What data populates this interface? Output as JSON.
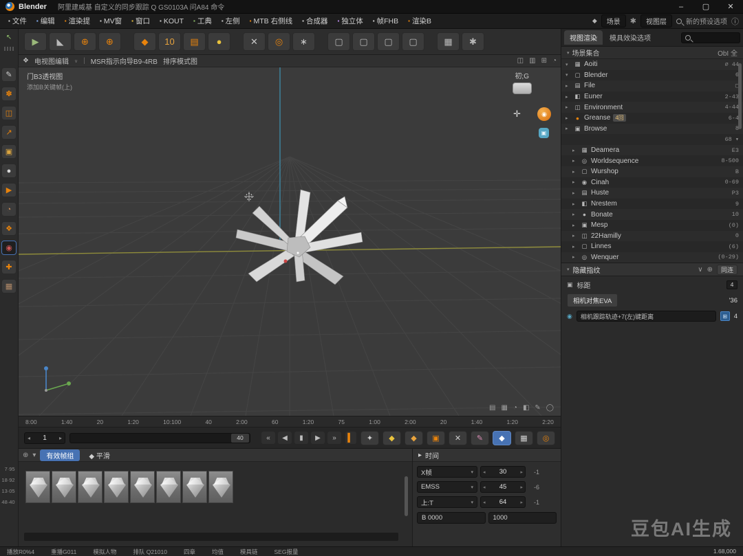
{
  "titlebar": {
    "app": "Blender",
    "title": "阿里建威基 自定义的同步跟踪 Q GS0103A 问A84 命令",
    "minimize": "–",
    "maximize": "▢",
    "close": "✕"
  },
  "menubar": {
    "items": [
      {
        "icon": "▪",
        "c": "#cfcfcf",
        "label": "文件"
      },
      {
        "icon": "▪",
        "c": "#8ab4f8",
        "label": "编辑"
      },
      {
        "icon": "▪",
        "c": "#e8830c",
        "label": "渲染提"
      },
      {
        "icon": "▪",
        "c": "#cfcfcf",
        "label": "MV窗"
      },
      {
        "icon": "▪",
        "c": "#e8c23d",
        "label": "窗口"
      },
      {
        "icon": "▪",
        "c": "#cfcfcf",
        "label": "KOUT"
      },
      {
        "icon": "▪",
        "c": "#8fbf6a",
        "label": "工典"
      },
      {
        "icon": "▪",
        "c": "#cfcfcf",
        "label": "左侧"
      },
      {
        "icon": "▪",
        "c": "#e8830c",
        "label": "MTB 右侧线"
      },
      {
        "icon": "▪",
        "c": "#cfcfcf",
        "label": "合成器"
      },
      {
        "icon": "▪",
        "c": "#b78ae8",
        "label": "独立体"
      },
      {
        "icon": "▪",
        "c": "#cfcfcf",
        "label": "帧FHB"
      },
      {
        "icon": "▪",
        "c": "#e8830c",
        "label": "渲染B"
      }
    ],
    "diamond": "◆",
    "scene_label": "场景",
    "gear": "✱",
    "layer_label": "视图层",
    "preset_label": "新的预设选项",
    "info": "ⓘ"
  },
  "toolbar": {
    "buttons": [
      {
        "g": "▶",
        "c": "#9ab87a",
        "gap": false
      },
      {
        "g": "◣",
        "c": "#b8b8b8",
        "gap": false
      },
      {
        "g": "⊕",
        "c": "#e8830c",
        "gap": false
      },
      {
        "g": "⊕",
        "c": "#e8830c",
        "gap": false
      },
      {
        "g": "◆",
        "c": "#e8830c",
        "gap": true
      },
      {
        "g": "10",
        "c": "#e8a33d",
        "gap": false
      },
      {
        "g": "▤",
        "c": "#e8830c",
        "gap": false
      },
      {
        "g": "●",
        "c": "#e8c23d",
        "gap": false
      },
      {
        "g": "✕",
        "c": "#c9c9c9",
        "gap": true
      },
      {
        "g": "◎",
        "c": "#e8830c",
        "gap": false
      },
      {
        "g": "∗",
        "c": "#c9c9c9",
        "gap": false
      },
      {
        "g": "▢",
        "c": "#b8b8b8",
        "gap": true
      },
      {
        "g": "▢",
        "c": "#b8b8b8",
        "gap": false
      },
      {
        "g": "▢",
        "c": "#b8b8b8",
        "gap": false
      },
      {
        "g": "▢",
        "c": "#b8b8b8",
        "gap": false
      },
      {
        "g": "▦",
        "c": "#b8b8b8",
        "gap": true
      },
      {
        "g": "✱",
        "c": "#b8b8b8",
        "gap": false
      }
    ]
  },
  "left_tools": {
    "chooser": "↖",
    "tools": [
      {
        "g": "✎",
        "c": "#cfcfcf",
        "selected": false
      },
      {
        "g": "✽",
        "c": "#e8830c",
        "selected": false
      },
      {
        "g": "◫",
        "c": "#e8830c",
        "selected": false
      },
      {
        "g": "↗",
        "c": "#e8830c",
        "selected": false
      },
      {
        "g": "▣",
        "c": "#d9a440",
        "selected": false
      },
      {
        "g": "●",
        "c": "#d8d8d8",
        "selected": false
      },
      {
        "g": "▶",
        "c": "#e8830c",
        "selected": false
      },
      {
        "g": "◔",
        "c": "#c98c5a",
        "selected": false
      },
      {
        "g": "❖",
        "c": "#e8830c",
        "selected": false
      },
      {
        "g": "◉",
        "c": "#cc5555",
        "selected": true
      },
      {
        "g": "✚",
        "c": "#e8830c",
        "selected": false
      },
      {
        "g": "▦",
        "c": "#b08968",
        "selected": false
      }
    ],
    "gutter": [
      "7·95",
      "18·92",
      "13·05",
      "48·40"
    ]
  },
  "viewport": {
    "header": {
      "icon": "❖",
      "title": "电视图编辑",
      "chev": "∨",
      "sep": "|",
      "path": "MSR指示向导B9-4RB",
      "mode": "排序模式图",
      "right_icons": [
        "◫",
        "▥",
        "⊞",
        "◔"
      ]
    },
    "overlay_line1": "门B3透视图",
    "overlay_line2": "添加B关键帧(上)",
    "gizmo_label": "初;G",
    "nav_cross": "✛",
    "nav_ball": "◉",
    "nav_cam": "▣",
    "corner_icons": [
      "▤",
      "▦",
      "◔",
      "◧",
      "✎",
      "◯"
    ]
  },
  "outliner": {
    "tabs": [
      {
        "label": "视图渲染",
        "active": true
      },
      {
        "label": "模具效染选项",
        "active": false
      }
    ],
    "header_left": "场景集合",
    "header_right": "ObI 全",
    "rows": [
      {
        "arrow": "▾",
        "icon": "▦",
        "c": "#b8b8b8",
        "label": "Aoiti",
        "badge": "",
        "right": "⌀ 44",
        "ind1": false
      },
      {
        "arrow": "▾",
        "icon": "▢",
        "c": "#b8b8b8",
        "label": "Blender",
        "badge": "",
        "right": "6",
        "ind1": false
      },
      {
        "arrow": "▸",
        "icon": "▤",
        "c": "#b8b8b8",
        "label": "File",
        "badge": "",
        "right": "▢",
        "ind1": false
      },
      {
        "arrow": "▸",
        "icon": "◧",
        "c": "#b8b8b8",
        "label": "Euner",
        "badge": "",
        "right": "2-43",
        "ind1": false
      },
      {
        "arrow": "▸",
        "icon": "◫",
        "c": "#b8b8b8",
        "label": "Environment",
        "badge": "",
        "right": "4-44",
        "ind1": false
      },
      {
        "arrow": "▸",
        "icon": "●",
        "c": "#e8830c",
        "label": "Greanse",
        "badge": "4回",
        "right": "6-4",
        "ind1": false
      },
      {
        "arrow": "▸",
        "icon": "▣",
        "c": "#b8b8b8",
        "label": "Browse",
        "badge": "",
        "right": "8",
        "ind1": false
      },
      {
        "arrow": "",
        "icon": "",
        "c": "#b8b8b8",
        "label": "",
        "badge": "",
        "right": "68 ▾",
        "ind1": false
      },
      {
        "arrow": "▸",
        "icon": "▦",
        "c": "#b8b8b8",
        "label": "Deamera",
        "badge": "",
        "right": "E3",
        "ind1": true
      },
      {
        "arrow": "▸",
        "icon": "◎",
        "c": "#b8b8b8",
        "label": "Worldsequence",
        "badge": "",
        "right": "8-500",
        "ind1": true
      },
      {
        "arrow": "▸",
        "icon": "▢",
        "c": "#b8b8b8",
        "label": "Wurshop",
        "badge": "",
        "right": "B",
        "ind1": true
      },
      {
        "arrow": "▸",
        "icon": "◉",
        "c": "#b8b8b8",
        "label": "Cinah",
        "badge": "",
        "right": "0-69",
        "ind1": true
      },
      {
        "arrow": "▸",
        "icon": "▤",
        "c": "#b8b8b8",
        "label": "Huste",
        "badge": "",
        "right": "P3",
        "ind1": true
      },
      {
        "arrow": "▸",
        "icon": "◧",
        "c": "#b8b8b8",
        "label": "Nrestem",
        "badge": "",
        "right": "9",
        "ind1": true
      },
      {
        "arrow": "▸",
        "icon": "●",
        "c": "#b8b8b8",
        "label": "Bonate",
        "badge": "",
        "right": "10",
        "ind1": true
      },
      {
        "arrow": "▸",
        "icon": "▣",
        "c": "#b8b8b8",
        "label": "Mesp",
        "badge": "",
        "right": "(0)",
        "ind1": true
      },
      {
        "arrow": "▸",
        "icon": "◫",
        "c": "#b8b8b8",
        "label": "22Hamilly",
        "badge": "",
        "right": "0",
        "ind1": true
      },
      {
        "arrow": "▸",
        "icon": "▢",
        "c": "#b8b8b8",
        "label": "Linnes",
        "badge": "",
        "right": "(6)",
        "ind1": true
      },
      {
        "arrow": "▸",
        "icon": "◎",
        "c": "#b8b8b8",
        "label": "Wenquer",
        "badge": "",
        "right": "(0-29)",
        "ind1": true
      }
    ]
  },
  "properties": {
    "title": "隐藏指纹",
    "chev": "∨",
    "btn1": "⊕",
    "btn2": "同连",
    "row1_icon": "▣",
    "row1_label": "标距",
    "row1_value": "4",
    "row2_tab": "相机对焦EVA",
    "row2_value": "'36",
    "row3_icon": "◉",
    "row3_field": "相机跟踪轨迹+7(左)键距离",
    "row3_badge": "⊞",
    "row3_value": "4"
  },
  "ruler": {
    "ticks": [
      "8:00",
      "1:40",
      "20",
      "1:20",
      "10:100",
      "40",
      "2:00",
      "60",
      "1:20",
      "75",
      "1:00",
      "2:00",
      "20",
      "1:40",
      "1:20",
      "2:20"
    ]
  },
  "playbar": {
    "frame": "1",
    "cap": "40",
    "transport": [
      "«",
      "◀",
      "▮",
      "▶",
      "»"
    ],
    "marker": "▍",
    "buttons": [
      {
        "g": "✦",
        "c": "#cfcfcf",
        "selected": false
      },
      {
        "g": "◆",
        "c": "#e8c23d",
        "selected": false
      },
      {
        "g": "◆",
        "c": "#e8a33d",
        "selected": false
      },
      {
        "g": "▣",
        "c": "#e8830c",
        "selected": false
      },
      {
        "g": "✕",
        "c": "#cfcfcf",
        "selected": false
      },
      {
        "g": "✎",
        "c": "#d98cb3",
        "selected": false
      },
      {
        "g": "◆",
        "c": "#ffffff",
        "selected": true
      },
      {
        "g": "▦",
        "c": "#cfcfcf",
        "selected": false
      },
      {
        "g": "◎",
        "c": "#e8830c",
        "selected": false
      }
    ]
  },
  "dopesheet": {
    "hicon1": "⊕",
    "hicon2": "▾",
    "tabs": [
      {
        "label": "有效帧组",
        "active": true
      },
      {
        "label": "◆ 平滑",
        "active": false
      }
    ]
  },
  "timepanel": {
    "title": "时间",
    "title_icon": "▸",
    "rows": [
      {
        "label": "X帧",
        "value": "30",
        "tail": "-1"
      },
      {
        "label": "EMSS",
        "value": "45",
        "tail": "-6"
      },
      {
        "label": "上:T",
        "value": "64",
        "tail": "-1"
      }
    ],
    "bottom_left": "B 0000",
    "bottom_right": "1000"
  },
  "statusbar": {
    "items": [
      "播放R0%4",
      "重播G011",
      "模拟人物",
      "排队 Q21010",
      "四章",
      "均值",
      "模具链",
      "SEG报量"
    ],
    "right": "1.68,000"
  },
  "watermark": "豆包AI生成",
  "colors": {
    "accent": "#4772b3",
    "orange": "#e8830c"
  }
}
